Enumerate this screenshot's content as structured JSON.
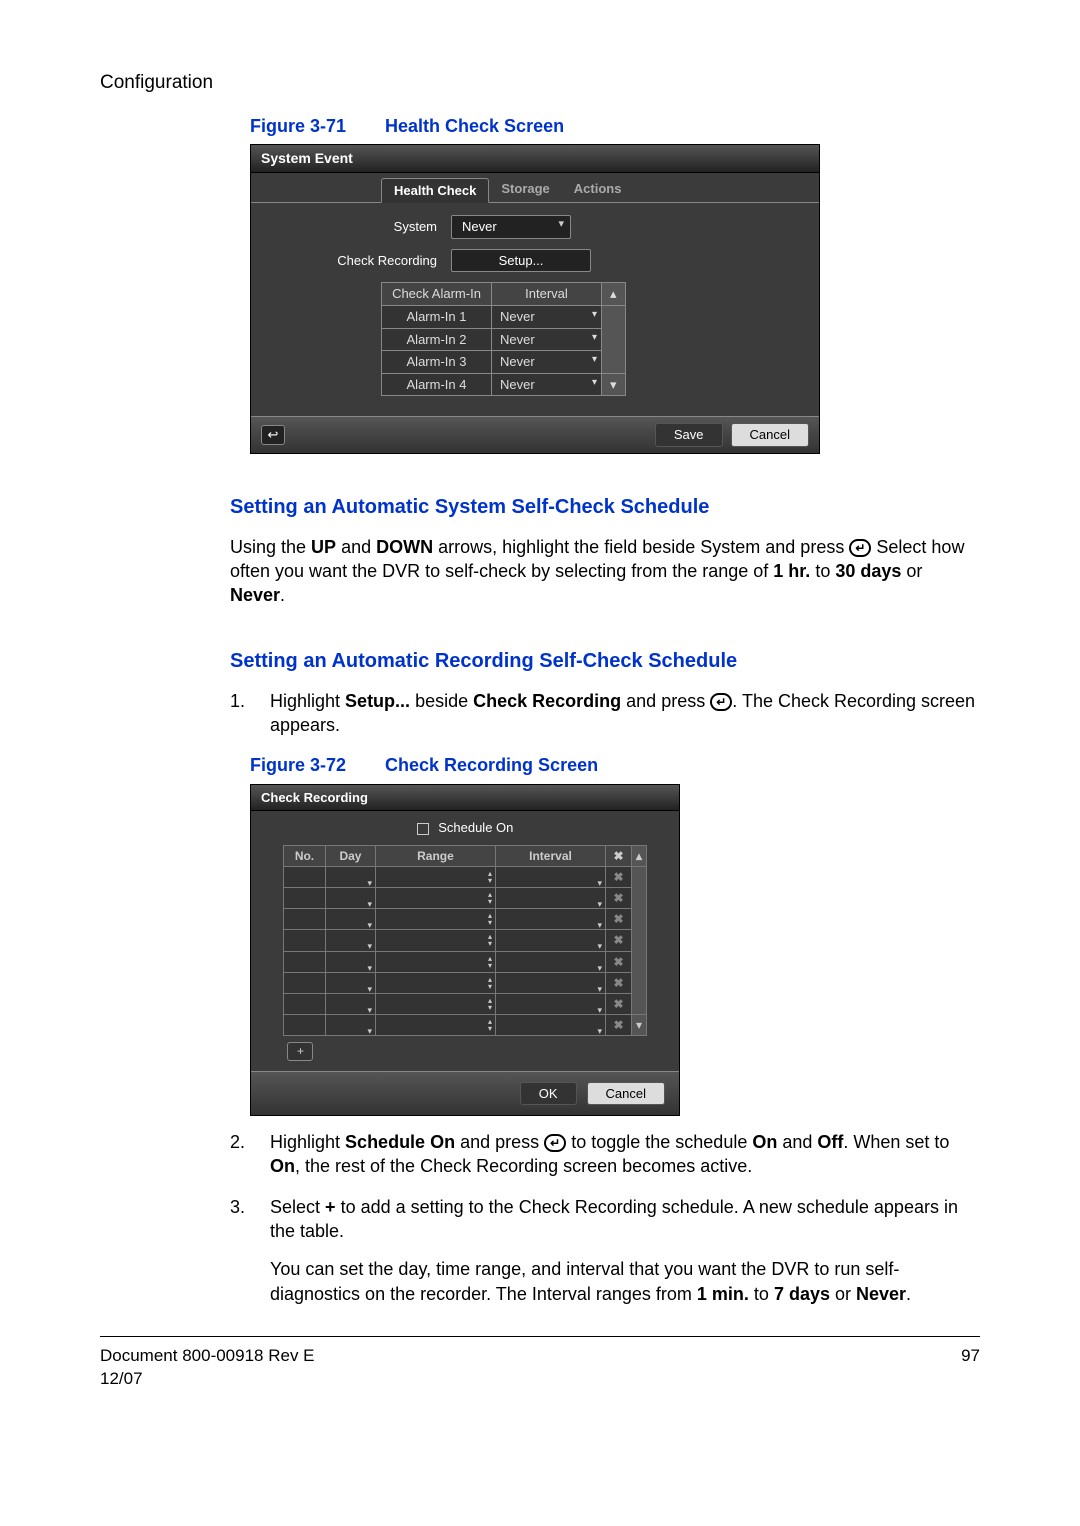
{
  "header": {
    "section": "Configuration"
  },
  "fig1": {
    "caption_num": "Figure 3-71",
    "caption_title": "Health Check Screen",
    "title": "System Event",
    "tabs": {
      "active": "Health Check",
      "storage": "Storage",
      "actions": "Actions"
    },
    "system_label": "System",
    "system_value": "Never",
    "checkrec_label": "Check Recording",
    "setup_btn": "Setup...",
    "table": {
      "h1": "Check Alarm-In",
      "h2": "Interval",
      "rows": [
        {
          "name": "Alarm-In 1",
          "interval": "Never"
        },
        {
          "name": "Alarm-In 2",
          "interval": "Never"
        },
        {
          "name": "Alarm-In 3",
          "interval": "Never"
        },
        {
          "name": "Alarm-In 4",
          "interval": "Never"
        }
      ]
    },
    "save": "Save",
    "cancel": "Cancel"
  },
  "h1": "Setting an Automatic System Self-Check Schedule",
  "p1a": "Using the ",
  "p1b": " and ",
  "p1c": " arrows, highlight the field beside System and press ",
  "p1d": " Select how often you want the DVR to self-check by selecting from the range of ",
  "p1e": " to ",
  "p1f": " or ",
  "p1g": ".",
  "bold": {
    "up": "UP",
    "down": "DOWN",
    "hr": "1 hr.",
    "days": "30 days",
    "never": "Never",
    "setup": "Setup...",
    "checkrec": "Check Recording",
    "schon": "Schedule On",
    "on": "On",
    "off": "Off",
    "plus": "+",
    "min": "1 min.",
    "sevendays": "7 days"
  },
  "h2": "Setting an Automatic Recording Self-Check Schedule",
  "step1a": "Highlight ",
  "step1b": " beside ",
  "step1c": " and press ",
  "step1d": ". The Check Recording screen appears.",
  "fig2": {
    "caption_num": "Figure 3-72",
    "caption_title": "Check Recording Screen",
    "title": "Check Recording",
    "schedule_on": "Schedule On",
    "h_no": "No.",
    "h_day": "Day",
    "h_range": "Range",
    "h_int": "Interval",
    "h_del": "✖",
    "add": "+",
    "ok": "OK",
    "cancel": "Cancel"
  },
  "step2a": "Highlight ",
  "step2b": " and press ",
  "step2c": " to toggle the schedule ",
  "step2d": " and ",
  "step2e": ". When set to ",
  "step2f": ", the rest of the Check Recording screen becomes active.",
  "step3a": "Select ",
  "step3b": " to add a setting to the Check Recording schedule. A new schedule appears in the table.",
  "step3c": "You can set the day, time range, and interval that you want the DVR to run self-diagnostics on the recorder. The Interval ranges from ",
  "step3d": " to ",
  "step3e": " or ",
  "step3f": ".",
  "footer": {
    "doc": "Document 800-00918 Rev E",
    "date": "12/07",
    "page": "97"
  }
}
